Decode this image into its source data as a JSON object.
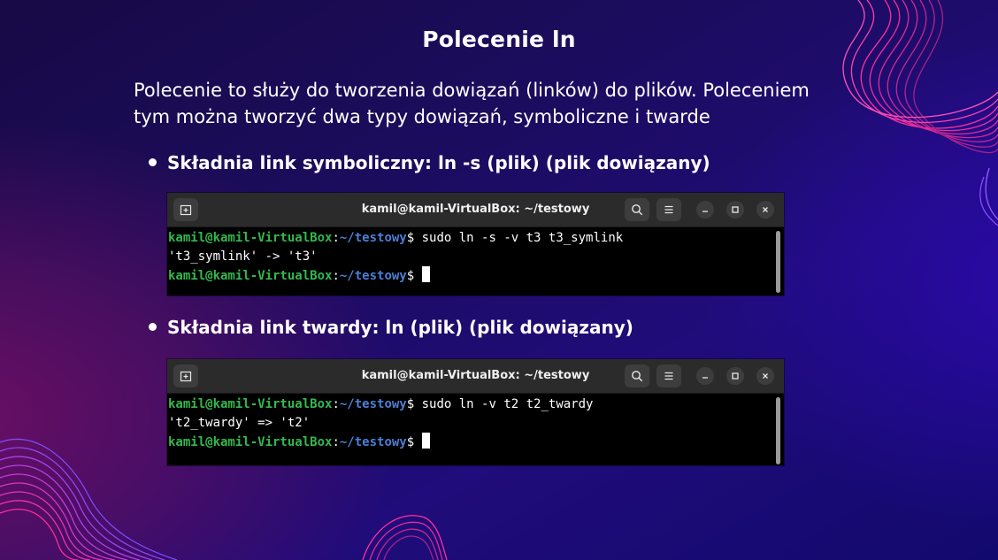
{
  "slide": {
    "title": "Polecenie ln",
    "intro": "Polecenie to służy do tworzenia dowiązań (linków) do plików. Poleceniem tym można tworzyć dwa typy dowiązań, symboliczne i twarde"
  },
  "bullets": [
    {
      "text": "Składnia link symboliczny: ln -s (plik) (plik dowiązany)"
    },
    {
      "text": "Składnia link twardy: ln (plik) (plik dowiązany)"
    }
  ],
  "terminals": [
    {
      "title": "kamil@kamil-VirtualBox: ~/testowy",
      "lines": [
        {
          "user": "kamil@kamil-VirtualBox",
          "sep": ":",
          "path": "~/testowy",
          "symbol": "$",
          "cmd": " sudo ln -s -v t3 t3_symlink"
        },
        {
          "output": "'t3_symlink' -> 't3'"
        },
        {
          "user": "kamil@kamil-VirtualBox",
          "sep": ":",
          "path": "~/testowy",
          "symbol": "$",
          "cmd": " "
        }
      ]
    },
    {
      "title": "kamil@kamil-VirtualBox: ~/testowy",
      "lines": [
        {
          "user": "kamil@kamil-VirtualBox",
          "sep": ":",
          "path": "~/testowy",
          "symbol": "$",
          "cmd": " sudo ln -v t2 t2_twardy"
        },
        {
          "output": "'t2_twardy' => 't2'"
        },
        {
          "user": "kamil@kamil-VirtualBox",
          "sep": ":",
          "path": "~/testowy",
          "symbol": "$",
          "cmd": " "
        }
      ]
    }
  ],
  "icons": [
    "new-tab-icon",
    "search-icon",
    "hamburger-menu-icon",
    "minimize-icon",
    "maximize-icon",
    "close-icon"
  ],
  "colors": {
    "background": "#1c0c5e",
    "accent_pink": "#e8238f",
    "accent_blue": "#4b6cf5",
    "prompt_user": "#33b84e",
    "prompt_path": "#4a7fd6",
    "terminal_bg": "#000000",
    "titlebar_bg": "#2b2b2b"
  }
}
